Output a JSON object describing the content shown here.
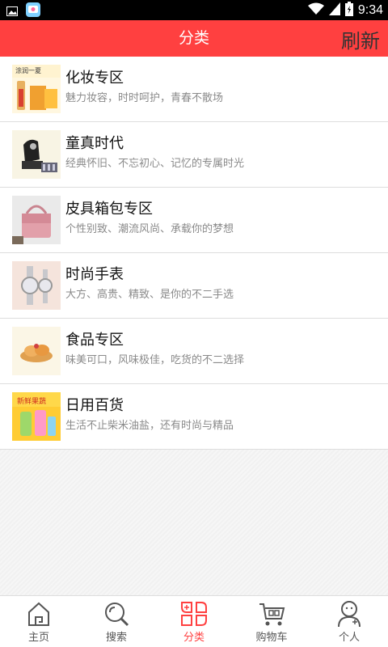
{
  "statusbar": {
    "time": "9:34"
  },
  "header": {
    "title": "分类",
    "refresh_label": "刷新"
  },
  "categories": [
    {
      "title": "化妆专区",
      "subtitle": "魅力妆容，时时呵护，青春不散场",
      "thumb_text": "涂润一夏"
    },
    {
      "title": "童真时代",
      "subtitle": "经典怀旧、不忘初心、记忆的专属时光"
    },
    {
      "title": "皮具箱包专区",
      "subtitle": "个性别致、潮流风尚、承载你的梦想"
    },
    {
      "title": "时尚手表",
      "subtitle": "大方、高贵、精致、是你的不二手选"
    },
    {
      "title": "食品专区",
      "subtitle": "味美可口，风味极佳，吃货的不二选择"
    },
    {
      "title": "日用百货",
      "subtitle": "生活不止柴米油盐，还有时尚与精品",
      "thumb_text": "新鲜果蔬"
    }
  ],
  "bottom_nav": [
    {
      "label": "主页",
      "icon": "home-icon"
    },
    {
      "label": "搜索",
      "icon": "search-icon"
    },
    {
      "label": "分类",
      "icon": "category-icon",
      "active": true
    },
    {
      "label": "购物车",
      "icon": "cart-icon"
    },
    {
      "label": "个人",
      "icon": "person-icon"
    }
  ],
  "colors": {
    "accent": "#ff4040",
    "refresh_text": "#333333",
    "subtitle": "#8a8a8a"
  }
}
